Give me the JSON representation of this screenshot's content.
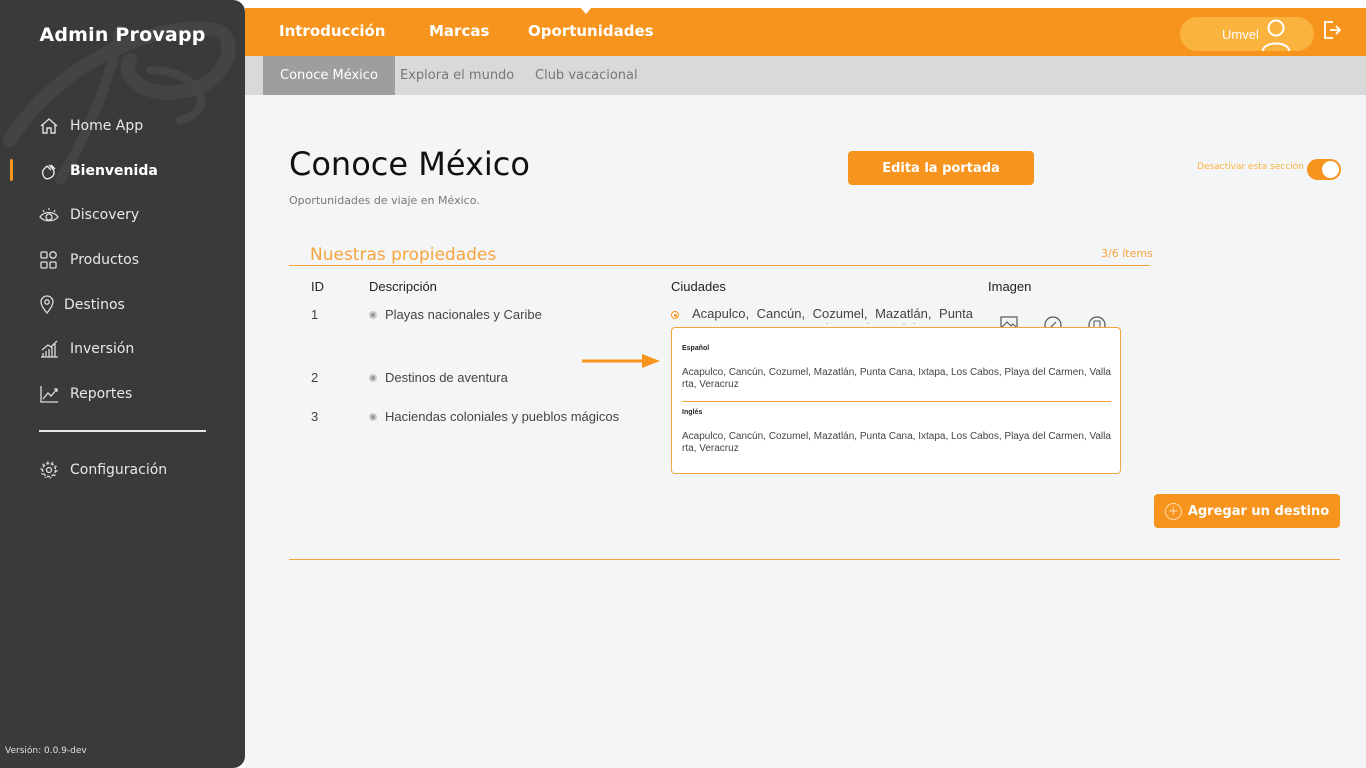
{
  "app": {
    "title": "Admin Provapp",
    "version": "Versión: 0.0.9-dev"
  },
  "sidebar": {
    "items": [
      {
        "label": "Home App",
        "icon": "home-icon"
      },
      {
        "label": "Bienvenida",
        "icon": "wave-hand-icon",
        "active": true
      },
      {
        "label": "Discovery",
        "icon": "eye-icon"
      },
      {
        "label": "Productos",
        "icon": "grid-icon"
      },
      {
        "label": "Destinos",
        "icon": "location-pin-icon"
      },
      {
        "label": "Inversión",
        "icon": "bar-chart-icon"
      },
      {
        "label": "Reportes",
        "icon": "line-chart-icon"
      }
    ],
    "config": {
      "label": "Configuración",
      "icon": "gear-icon"
    }
  },
  "topnav": {
    "tabs": [
      "Introducción",
      "Marcas",
      "Oportunidades"
    ],
    "active_tab": "Oportunidades",
    "user": "Umvel"
  },
  "subnav": {
    "tabs": [
      "Conoce México",
      "Explora el mundo",
      "Club vacacional"
    ],
    "active_tab": "Conoce México"
  },
  "page": {
    "title": "Conoce México",
    "subtitle": "Oportunidades de viaje en México.",
    "edit_cover": "Edita la portada",
    "toggle_label": "Desactivar esta sección",
    "toggle_on": true
  },
  "properties": {
    "title": "Nuestras propiedades",
    "count": "3/6 ítems",
    "headers": {
      "id": "ID",
      "description": "Descripción",
      "cities": "Ciudades",
      "image": "Imagen"
    },
    "rows": [
      {
        "id": "1",
        "description": "Playas nacionales y Caribe",
        "cities": "Acapulco, Cancún, Cozumel, Mazatlán, Punta Cana, Ixtapa, Los Cabos, Playa del Carmen, Vallarta, Veracruz"
      },
      {
        "id": "2",
        "description": "Destinos de aventura"
      },
      {
        "id": "3",
        "description": "Haciendas coloniales y pueblos mágicos"
      }
    ],
    "popup": {
      "spanish_label": "Español",
      "spanish_text": "Acapulco, Cancún, Cozumel, Mazatlán, Punta Cana, Ixtapa, Los Cabos, Playa del Carmen, Vallarta, Veracruz",
      "english_label": "Inglés",
      "english_text": "Acapulco, Cancún, Cozumel, Mazatlán, Punta Cana, Ixtapa, Los Cabos, Playa del Carmen, Vallarta, Veracruz"
    },
    "add_button": "Agregar un destino"
  },
  "colors": {
    "accent": "#f7941d",
    "sidebar": "#3a3a3a",
    "subnav": "#d9d9d9",
    "content_bg": "#f4f5f7"
  }
}
